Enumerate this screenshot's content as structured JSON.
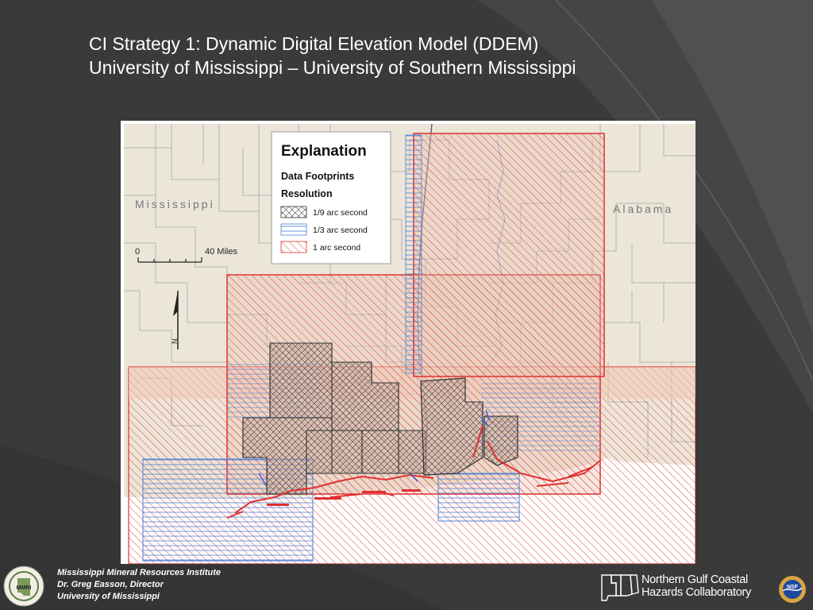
{
  "slide": {
    "title_line1": "CI Strategy 1: Dynamic Digital Elevation Model (DDEM)",
    "title_line2": "University of Mississippi – University of Southern Mississippi"
  },
  "map": {
    "state_left": "Mississippi",
    "state_right": "Alabama",
    "scale_start": "0",
    "scale_end": "40 Miles",
    "north_label": "N",
    "legend": {
      "title": "Explanation",
      "subtitle1": "Data Footprints",
      "subtitle2": "Resolution",
      "items": [
        {
          "label": "1/9 arc second",
          "pattern": "crosshatch",
          "color": "#333333"
        },
        {
          "label": "1/3 arc second",
          "pattern": "horizontal",
          "color": "#4a7fd6"
        },
        {
          "label": "1 arc second",
          "pattern": "diagonal",
          "color": "#e03030"
        }
      ]
    }
  },
  "footer": {
    "line1": "Mississippi Mineral Resources Institute",
    "line2": "Dr. Greg Easson, Director",
    "line3": "University of Mississippi"
  },
  "logos": {
    "ngchc_line1": "Northern Gulf Coastal",
    "ngchc_line2": "Hazards Collaboratory",
    "nsf": "NSF",
    "mmri": "MMRI"
  },
  "colors": {
    "background": "#3a3a3a",
    "land": "#ece6d9",
    "county_lines": "#a0a0a0",
    "red_footprint": "#e03030",
    "blue_footprint": "#4a7fd6",
    "hatch_tint": "#e5c7b6"
  }
}
